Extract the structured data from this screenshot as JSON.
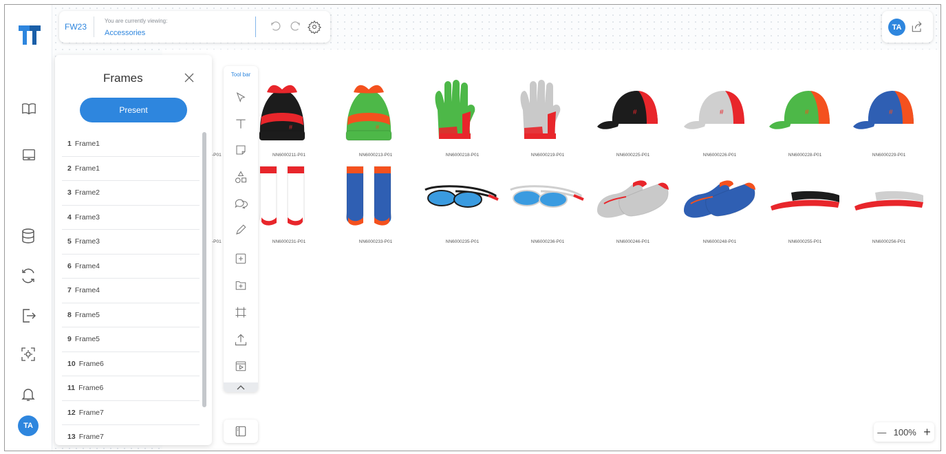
{
  "header": {
    "season": "FW23",
    "viewing_label": "You are currently viewing:",
    "viewing_value": "Accessories",
    "user_initials": "TA"
  },
  "sidebar": {
    "avatar_initials": "TA",
    "items": [
      {
        "icon": "book-icon"
      },
      {
        "icon": "laptop-icon"
      },
      {
        "icon": "database-icon"
      },
      {
        "icon": "sync-icon"
      },
      {
        "icon": "export-icon"
      },
      {
        "icon": "scan-icon"
      },
      {
        "icon": "bell-icon"
      }
    ]
  },
  "frames_panel": {
    "title": "Frames",
    "present_label": "Present",
    "frames": [
      {
        "num": "1",
        "name": "Frame1"
      },
      {
        "num": "2",
        "name": "Frame1"
      },
      {
        "num": "3",
        "name": "Frame2"
      },
      {
        "num": "4",
        "name": "Frame3"
      },
      {
        "num": "5",
        "name": "Frame3"
      },
      {
        "num": "6",
        "name": "Frame4"
      },
      {
        "num": "7",
        "name": "Frame4"
      },
      {
        "num": "8",
        "name": "Frame5"
      },
      {
        "num": "9",
        "name": "Frame5"
      },
      {
        "num": "10",
        "name": "Frame6"
      },
      {
        "num": "11",
        "name": "Frame6"
      },
      {
        "num": "12",
        "name": "Frame7"
      },
      {
        "num": "13",
        "name": "Frame7"
      }
    ]
  },
  "toolbar": {
    "label": "Tool bar"
  },
  "zoom": {
    "minus": "—",
    "value": "100%",
    "plus": "+"
  },
  "products": {
    "row1": [
      {
        "code": "-P01",
        "kind": "beanie-partial"
      },
      {
        "code": "NN6000211-P01",
        "kind": "beanie",
        "main": "#1c1c1c",
        "accent": "#e8262b"
      },
      {
        "code": "NN6000213-P01",
        "kind": "beanie",
        "main": "#4db848",
        "accent": "#f4511e"
      },
      {
        "code": "NN6000218-P01",
        "kind": "glove",
        "main": "#4db848",
        "accent": "#e8262b"
      },
      {
        "code": "NN6000219-P01",
        "kind": "glove",
        "main": "#c9c9c9",
        "accent": "#e8262b"
      },
      {
        "code": "NN6000225-P01",
        "kind": "cap",
        "main": "#1c1c1c",
        "accent": "#e8262b"
      },
      {
        "code": "NN6000226-P01",
        "kind": "cap",
        "main": "#cfcfcf",
        "accent": "#e8262b"
      },
      {
        "code": "NN6000228-P01",
        "kind": "cap",
        "main": "#4db848",
        "accent": "#f4511e"
      },
      {
        "code": "NN6000229-P01",
        "kind": "cap",
        "main": "#2f5fb3",
        "accent": "#f4511e"
      }
    ],
    "row2": [
      {
        "code": "-P01",
        "kind": "sock-partial"
      },
      {
        "code": "NN6000231-P01",
        "kind": "socks",
        "main": "#ffffff",
        "accent": "#e8262b"
      },
      {
        "code": "NN6000233-P01",
        "kind": "socks",
        "main": "#2f5fb3",
        "accent": "#f4511e"
      },
      {
        "code": "NN6000235-P01",
        "kind": "glasses",
        "main": "#1c1c1c",
        "accent": "#3a9be0"
      },
      {
        "code": "NN6000236-P01",
        "kind": "glasses",
        "main": "#cfcfcf",
        "accent": "#3a9be0"
      },
      {
        "code": "NN6000246-P01",
        "kind": "shoes",
        "main": "#c9c9c9",
        "accent": "#e8262b"
      },
      {
        "code": "NN6000248-P01",
        "kind": "shoes",
        "main": "#2f5fb3",
        "accent": "#f4511e"
      },
      {
        "code": "NN6000255-P01",
        "kind": "visor",
        "main": "#1c1c1c",
        "accent": "#e8262b"
      },
      {
        "code": "NN6000256-P01",
        "kind": "visor",
        "main": "#cfcfcf",
        "accent": "#e8262b"
      }
    ]
  }
}
